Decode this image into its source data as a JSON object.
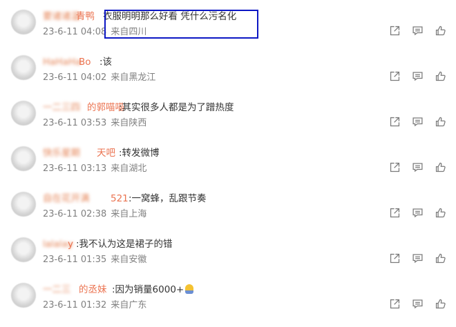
{
  "comments": [
    {
      "author_blur": "要诸诸温",
      "author_tail": "青鸭",
      "text": "衣服明明那么好看 凭什么污名化",
      "date": "23-6-11 04:08",
      "location": "来自四川"
    },
    {
      "author_blur": "HaHaHa",
      "author_tail": "Bo",
      "text": ":该",
      "date": "23-6-11 04:02",
      "location": "来自黑龙江"
    },
    {
      "author_blur": "一二三四",
      "author_tail": "的郭喵喵",
      "text": ":其实很多人都是为了蹭热度",
      "date": "23-6-11 03:53",
      "location": "来自陕西"
    },
    {
      "author_blur": "快乐星期",
      "author_tail": "天吧",
      "text": ":转发微博",
      "date": "23-6-11 03:13",
      "location": "来自湖北"
    },
    {
      "author_blur": "自在花开满",
      "author_tail": "521",
      "text": ":一窝蜂，乱跟节奏",
      "date": "23-6-11 02:38",
      "location": "来自上海"
    },
    {
      "author_blur": "lalalay",
      "author_tail": "y",
      "text": ":我不认为这是裙子的错",
      "date": "23-6-11 01:35",
      "location": "来自安徽"
    },
    {
      "author_blur": "一二三",
      "author_tail": "的丞妹",
      "text": ":因为销量6000+",
      "date": "23-6-11 01:32",
      "location": "来自广东"
    }
  ],
  "actions": [
    {
      "name": "share-icon"
    },
    {
      "name": "comment-icon"
    },
    {
      "name": "like-icon"
    }
  ],
  "colors": {
    "author": "#eb7350",
    "text": "#333333",
    "meta": "#808080",
    "icon": "#7a7a7a",
    "highlight_box": "#0b16c4"
  }
}
